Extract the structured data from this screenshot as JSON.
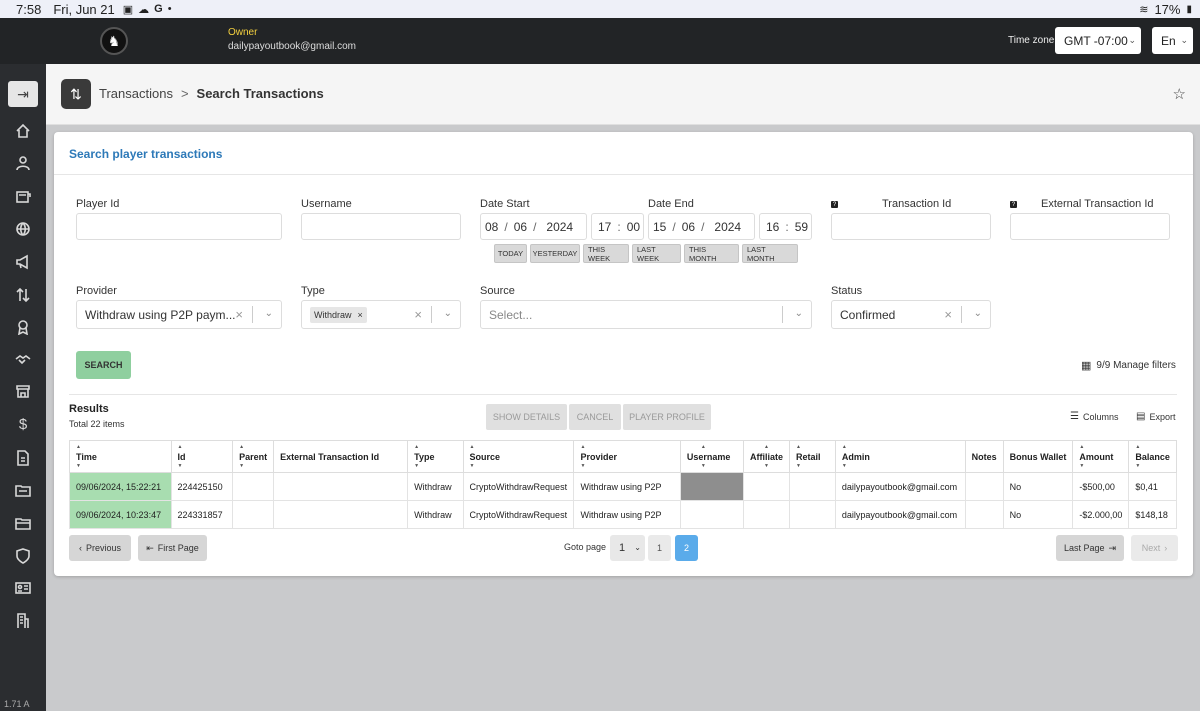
{
  "statusbar": {
    "time": "7:58",
    "date": "Fri, Jun 21",
    "battery": "17%"
  },
  "topbar": {
    "role": "Owner",
    "email": "dailypayoutbook@gmail.com",
    "tz_label": "Time zone",
    "tz_value": "GMT -07:00",
    "lang": "En"
  },
  "sidebar": {
    "version": "1.71 A"
  },
  "header": {
    "crumb_parent": "Transactions",
    "crumb_sep": ">",
    "crumb_current": "Search Transactions"
  },
  "panel": {
    "title": "Search player transactions"
  },
  "filters": {
    "player_id_label": "Player Id",
    "username_label": "Username",
    "date_start_label": "Date Start",
    "date_end_label": "Date End",
    "date_start": {
      "dd": "08",
      "mm": "06",
      "yyyy": "2024",
      "hh": "17",
      "min": "00"
    },
    "date_end": {
      "dd": "15",
      "mm": "06",
      "yyyy": "2024",
      "hh": "16",
      "min": "59"
    },
    "quick": [
      "TODAY",
      "YESTERDAY",
      "THIS WEEK",
      "LAST WEEK",
      "THIS MONTH",
      "LAST MONTH"
    ],
    "transaction_id_label": "Transaction Id",
    "external_id_label": "External Transaction Id",
    "provider_label": "Provider",
    "provider_value": "Withdraw using P2P paym...",
    "type_label": "Type",
    "type_tag": "Withdraw",
    "source_label": "Source",
    "source_placeholder": "Select...",
    "status_label": "Status",
    "status_value": "Confirmed",
    "search_btn": "SEARCH",
    "manage_filters": "9/9 Manage filters"
  },
  "results": {
    "title": "Results",
    "count": "Total 22 items",
    "actions": [
      "SHOW DETAILS",
      "CANCEL",
      "PLAYER PROFILE"
    ],
    "columns_btn": "Columns",
    "export_btn": "Export",
    "headers": [
      "Time",
      "Id",
      "Parent",
      "External Transaction Id",
      "Type",
      "Source",
      "Provider",
      "Username",
      "Affiliate",
      "Retail",
      "Admin",
      "Notes",
      "Bonus Wallet",
      "Amount",
      "Balance"
    ],
    "rows": [
      [
        "09/06/2024, 15:22:21",
        "224425150",
        "",
        "",
        "Withdraw",
        "CryptoWithdrawRequest",
        "Withdraw using P2P",
        "",
        "",
        "",
        "dailypayoutbook@gmail.com",
        "",
        "No",
        "-$500,00",
        "$0,41"
      ],
      [
        "09/06/2024, 10:23:47",
        "224331857",
        "",
        "",
        "Withdraw",
        "CryptoWithdrawRequest",
        "Withdraw using P2P",
        "",
        "",
        "",
        "dailypayoutbook@gmail.com",
        "",
        "No",
        "-$2.000,00",
        "$148,18"
      ]
    ]
  },
  "pagination": {
    "previous": "Previous",
    "first": "First Page",
    "goto_label": "Goto page",
    "goto_value": "1",
    "pages": [
      "1",
      "2"
    ],
    "current": "2",
    "last": "Last Page",
    "next": "Next"
  }
}
